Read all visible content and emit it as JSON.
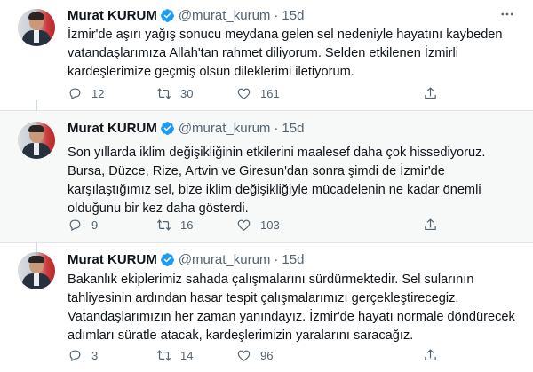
{
  "tweets": [
    {
      "name": "Murat KURUM",
      "handle": "@murat_kurum",
      "separator": "·",
      "time": "15d",
      "lines": [
        "İzmir'de aşırı yağış sonucu meydana gelen sel nedeniyle hayatını kaybeden",
        "vatandaşlarımıza Allah'tan rahmet diliyorum. Selden etkilenen İzmirli",
        "kardeşlerimize geçmiş olsun dileklerimi iletiyorum."
      ],
      "replies": "12",
      "retweets": "30",
      "likes": "161"
    },
    {
      "name": "Murat KURUM",
      "handle": "@murat_kurum",
      "separator": "·",
      "time": "15d",
      "lines": [
        "Son yıllarda iklim değişikliğinin etkilerini maalesef daha çok hissediyoruz.",
        "Bursa, Düzce, Rize, Artvin ve Giresun'dan sonra şimdi de İzmir'de",
        "karşılaştığımız sel, bize iklim değişikliğiyle mücadelenin ne kadar önemli",
        "olduğunu bir kez daha gösterdi."
      ],
      "replies": "9",
      "retweets": "16",
      "likes": "103"
    },
    {
      "name": "Murat KURUM",
      "handle": "@murat_kurum",
      "separator": "·",
      "time": "15d",
      "lines": [
        "Bakanlık ekiplerimiz sahada çalışmalarını sürdürmektedir. Sel sularının",
        "tahliyesinin ardından hasar tespit çalışmalarımızı gerçekleştirecegiz.",
        "Vatandaşlarımızın her zaman yanındayız. İzmir'de hayatı normale döndürecek",
        "adımları süratle atacak, kardeşlerimizin yaralarını saracağız."
      ],
      "replies": "3",
      "retweets": "14",
      "likes": "96"
    }
  ],
  "icons": {
    "verified": "verified-badge-icon",
    "more": "more-options-icon",
    "reply": "reply-icon",
    "retweet": "retweet-icon",
    "like": "heart-icon",
    "share": "share-icon"
  },
  "colors": {
    "verified_blue": "#1d9bf0",
    "secondary_text": "#536471",
    "highlight_bg": "#f7f9f9"
  }
}
